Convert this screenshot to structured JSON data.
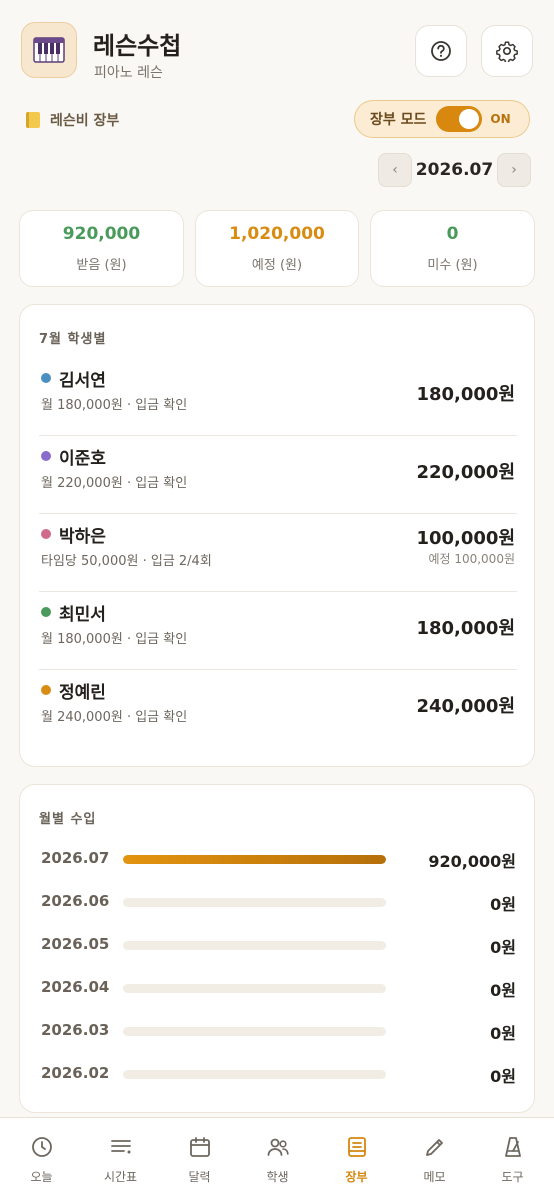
{
  "header": {
    "title": "레슨수첩",
    "subtitle": "피아노 레슨",
    "app_icon": "piano-icon",
    "help_icon": "question-circle-icon",
    "settings_icon": "gear-icon"
  },
  "ledger": {
    "section_label": "레슨비 장부",
    "mode_label": "장부 모드",
    "mode_state": "ON",
    "month": "2026.07",
    "prev_arrow": "‹",
    "next_arrow": "›"
  },
  "summary": {
    "received": {
      "amount": "920,000",
      "label": "받음 (원)",
      "color": "#4a9a5c"
    },
    "scheduled": {
      "amount": "1,020,000",
      "label": "예정 (원)",
      "color": "#d98c12"
    },
    "unpaid": {
      "amount": "0",
      "label": "미수 (원)",
      "color": "#4a9a5c"
    }
  },
  "students": {
    "title": "7월 학생별",
    "items": [
      {
        "name": "김서연",
        "detail": "월 180,000원 · 입금 확인",
        "amount": "180,000원",
        "expected": "",
        "color": "#4a8fc0"
      },
      {
        "name": "이준호",
        "detail": "월 220,000원 · 입금 확인",
        "amount": "220,000원",
        "expected": "",
        "color": "#8a6ccf"
      },
      {
        "name": "박하은",
        "detail": "타임당 50,000원 · 입금 2/4회",
        "amount": "100,000원",
        "expected": "예정 100,000원",
        "color": "#cf6a8a"
      },
      {
        "name": "최민서",
        "detail": "월 180,000원 · 입금 확인",
        "amount": "180,000원",
        "expected": "",
        "color": "#4a9a5c"
      },
      {
        "name": "정예린",
        "detail": "월 240,000원 · 입금 확인",
        "amount": "240,000원",
        "expected": "",
        "color": "#d98c12"
      }
    ]
  },
  "monthly_income": {
    "title": "월별 수입",
    "rows": [
      {
        "month": "2026.07",
        "amount": "920,000원",
        "fraction": 1.0
      },
      {
        "month": "2026.06",
        "amount": "0원",
        "fraction": 0
      },
      {
        "month": "2026.05",
        "amount": "0원",
        "fraction": 0
      },
      {
        "month": "2026.04",
        "amount": "0원",
        "fraction": 0
      },
      {
        "month": "2026.03",
        "amount": "0원",
        "fraction": 0
      },
      {
        "month": "2026.02",
        "amount": "0원",
        "fraction": 0
      }
    ]
  },
  "nav": {
    "items": [
      {
        "label": "오늘",
        "icon": "clock-icon",
        "active": false
      },
      {
        "label": "시간표",
        "icon": "list-icon",
        "active": false
      },
      {
        "label": "달력",
        "icon": "calendar-icon",
        "active": false
      },
      {
        "label": "학생",
        "icon": "people-icon",
        "active": false
      },
      {
        "label": "장부",
        "icon": "ledger-book-icon",
        "active": true
      },
      {
        "label": "메모",
        "icon": "pencil-icon",
        "active": false
      },
      {
        "label": "도구",
        "icon": "metronome-icon",
        "active": false
      }
    ],
    "active_color": "#d4870f"
  }
}
